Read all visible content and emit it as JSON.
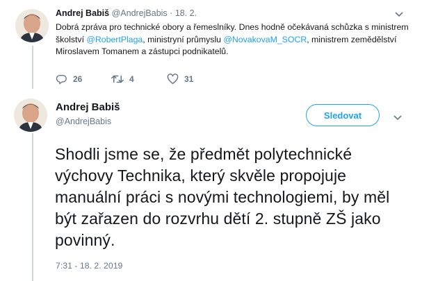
{
  "tweet1": {
    "author_name": "Andrej Babiš",
    "handle": "@AndrejBabis",
    "separator": "·",
    "date": "18. 2.",
    "text_part1": "Dobrá zpráva pro technické obory a řemeslníky. Dnes hodně očekávaná schůzka s ministrem školství ",
    "mention_plaga": "@RobertPlaga",
    "text_part2": ", ministryní průmyslu ",
    "mention_novakova": "@NovakovaM_SOCR",
    "text_part3": ", ministrem zemědělství Miroslavem Tomanem a zástupci podnikatelů.",
    "replies": "26",
    "retweets": "4",
    "likes": "31"
  },
  "tweet2": {
    "author_name": "Andrej Babiš",
    "handle": "@AndrejBabis",
    "follow_label": "Sledovat",
    "text": "Shodli jsme se, že předmět polytechnické výchovy Technika, který skvěle propojuje manuální práci s novými technologiemi, by měl být zařazen do rozvrhu dětí 2. stupně ZŠ jako povinný.",
    "timestamp": "7:31 - 18. 2. 2019"
  },
  "colors": {
    "accent": "#1da1f2",
    "muted": "#657786",
    "text": "#14171a",
    "thread_line": "#ccd6dd"
  },
  "icons": [
    "avatar",
    "chevron-down-icon",
    "reply-icon",
    "retweet-icon",
    "like-icon"
  ]
}
